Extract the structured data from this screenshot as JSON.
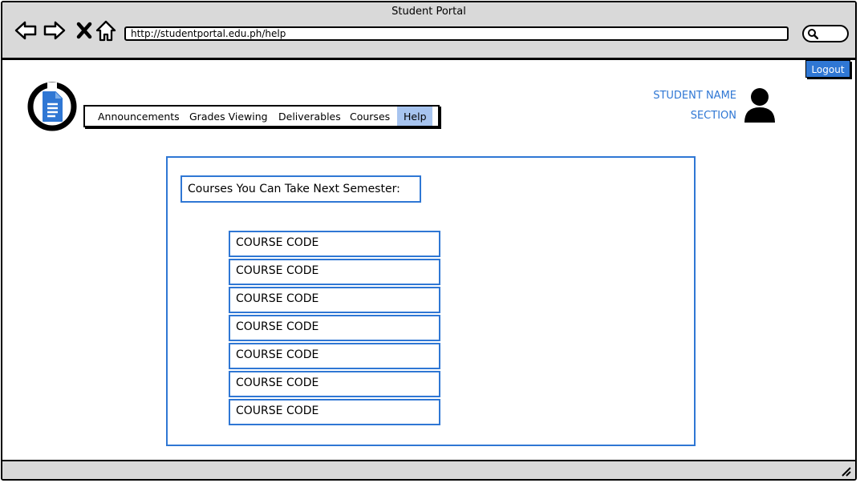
{
  "window": {
    "title": "Student Portal"
  },
  "browser": {
    "url": "http://studentportal.edu.ph/help",
    "nav_icons": [
      "back-arrow-icon",
      "forward-arrow-icon",
      "close-x-icon",
      "home-icon"
    ],
    "search_icon": "search-icon"
  },
  "header": {
    "logout_label": "Logout",
    "logo_icon": "document-icon",
    "menu": [
      {
        "label": "Announcements",
        "active": false
      },
      {
        "label": "Grades Viewing",
        "active": false
      },
      {
        "label": "Deliverables",
        "active": false
      },
      {
        "label": "Courses",
        "active": false
      },
      {
        "label": "Help",
        "active": true
      }
    ],
    "user": {
      "name": "STUDENT NAME",
      "section": "SECTION",
      "avatar_icon": "user-avatar-icon"
    }
  },
  "main": {
    "heading": "Courses You Can Take Next Semester:",
    "courses": [
      "COURSE CODE",
      "COURSE CODE",
      "COURSE CODE",
      "COURSE CODE",
      "COURSE CODE",
      "COURSE CODE",
      "COURSE CODE"
    ]
  },
  "colors": {
    "accent": "#2f77d4",
    "active_tab": "#a7c4ef",
    "chrome": "#d9d9d9"
  }
}
